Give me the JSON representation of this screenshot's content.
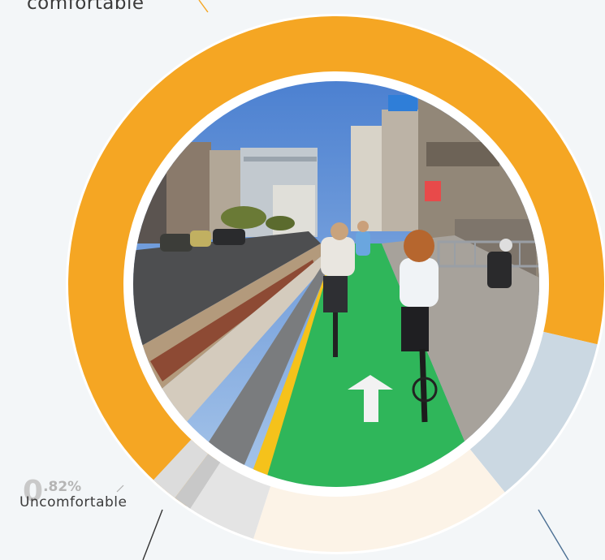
{
  "chart_data": {
    "type": "pie",
    "style": "donut",
    "center_image": "protected-green-bike-lane-photo",
    "slices": [
      {
        "label": "comfortable",
        "color": "#f5a623"
      },
      {
        "label": "",
        "color": "#cbd8e2"
      },
      {
        "label": "",
        "color": "#fcf3e7"
      },
      {
        "label": "",
        "color": "#e4e4e4"
      },
      {
        "label": "",
        "color": "#c8c8c8"
      },
      {
        "label": "Uncomfortable",
        "value": 0.82,
        "value_text": "0.82%",
        "color": "#dcdcdc"
      }
    ]
  },
  "labels": {
    "top_word": "comfortable",
    "uncomfortable_big": "0",
    "uncomfortable_small": ".82%",
    "uncomfortable": "Uncomfortable"
  }
}
